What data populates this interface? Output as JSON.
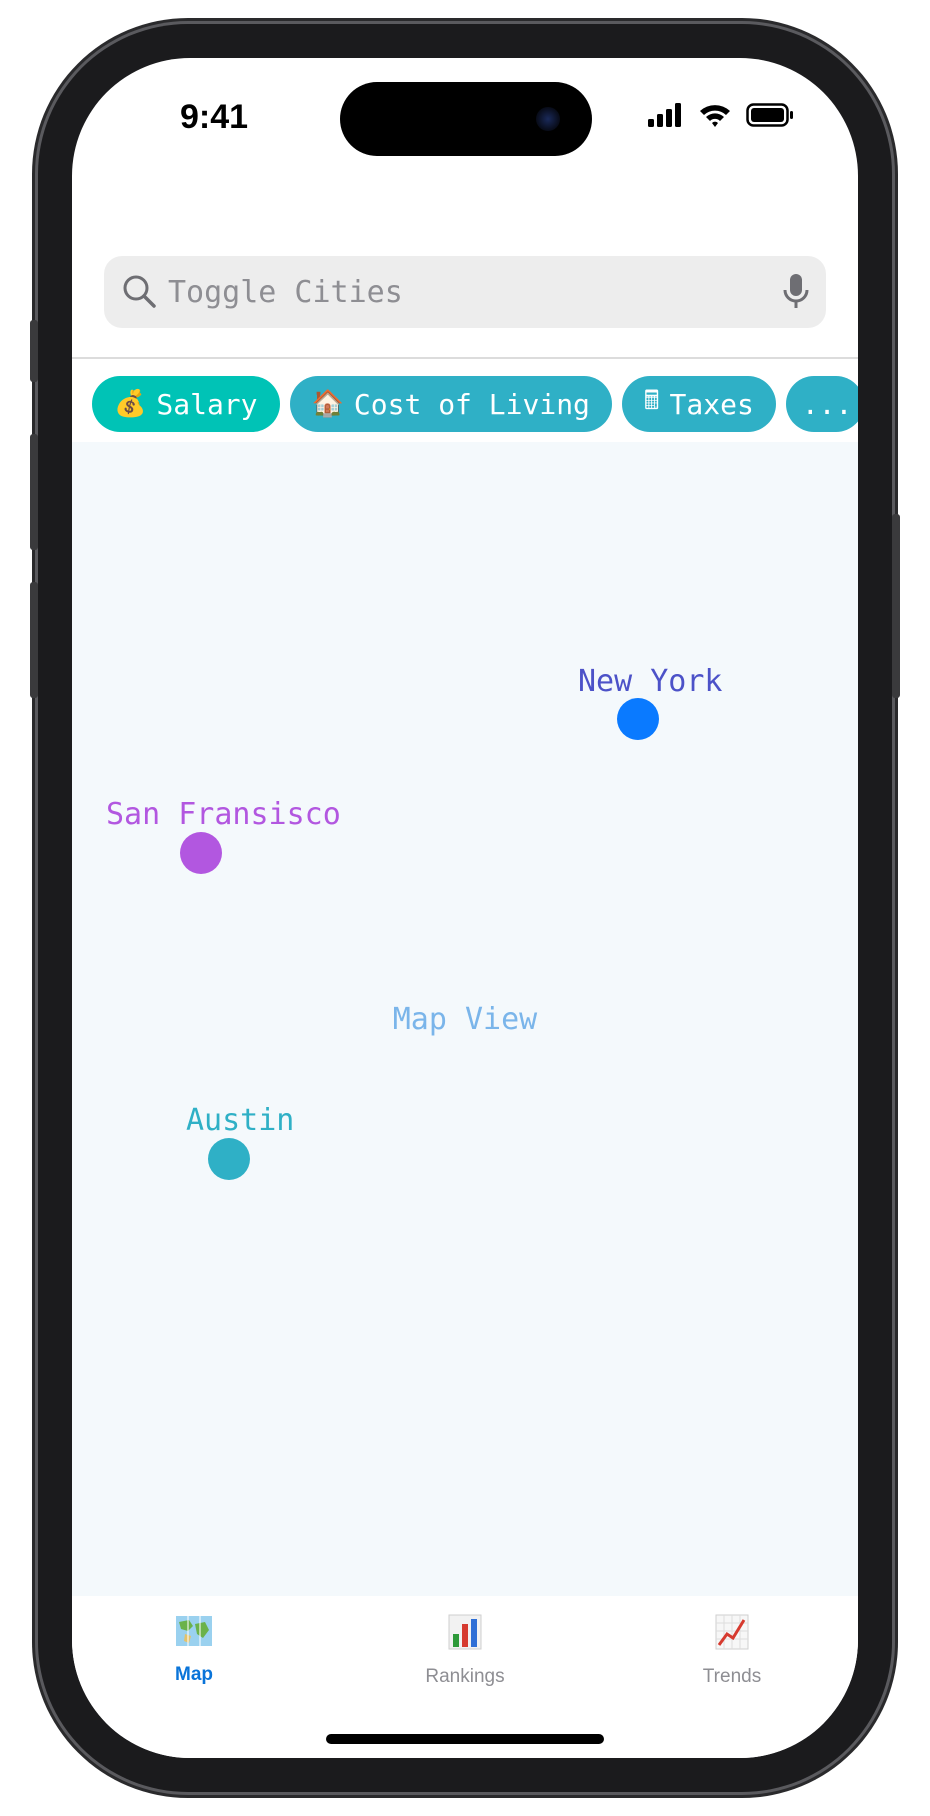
{
  "status_bar": {
    "time": "9:41"
  },
  "search": {
    "placeholder": "Toggle Cities"
  },
  "chips": [
    {
      "emoji": "💰",
      "label": "Salary",
      "active": true
    },
    {
      "emoji": "🏠",
      "label": "Cost of Living",
      "active": false
    },
    {
      "emoji": "🖩",
      "label": "Taxes",
      "active": false
    },
    {
      "emoji": "",
      "label": "...",
      "active": false
    }
  ],
  "map": {
    "label": "Map View",
    "cities": [
      {
        "name": "New York",
        "color": "#0a7aff",
        "label_color": "#4c52c8"
      },
      {
        "name": "San Fransisco",
        "color": "#b257e0",
        "label_color": "#b257e0"
      },
      {
        "name": "Austin",
        "color": "#2fb0c6",
        "label_color": "#2fb0c6"
      }
    ]
  },
  "tabs": [
    {
      "label": "Map",
      "icon": "map-icon",
      "active": true
    },
    {
      "label": "Rankings",
      "icon": "bar-chart-icon",
      "active": false
    },
    {
      "label": "Trends",
      "icon": "trend-chart-icon",
      "active": false
    }
  ],
  "colors": {
    "accent": "#0a74d9",
    "chip": "#2fb0c6",
    "chip_active": "#00c3b6",
    "map_bg": "#f4f9fc"
  }
}
